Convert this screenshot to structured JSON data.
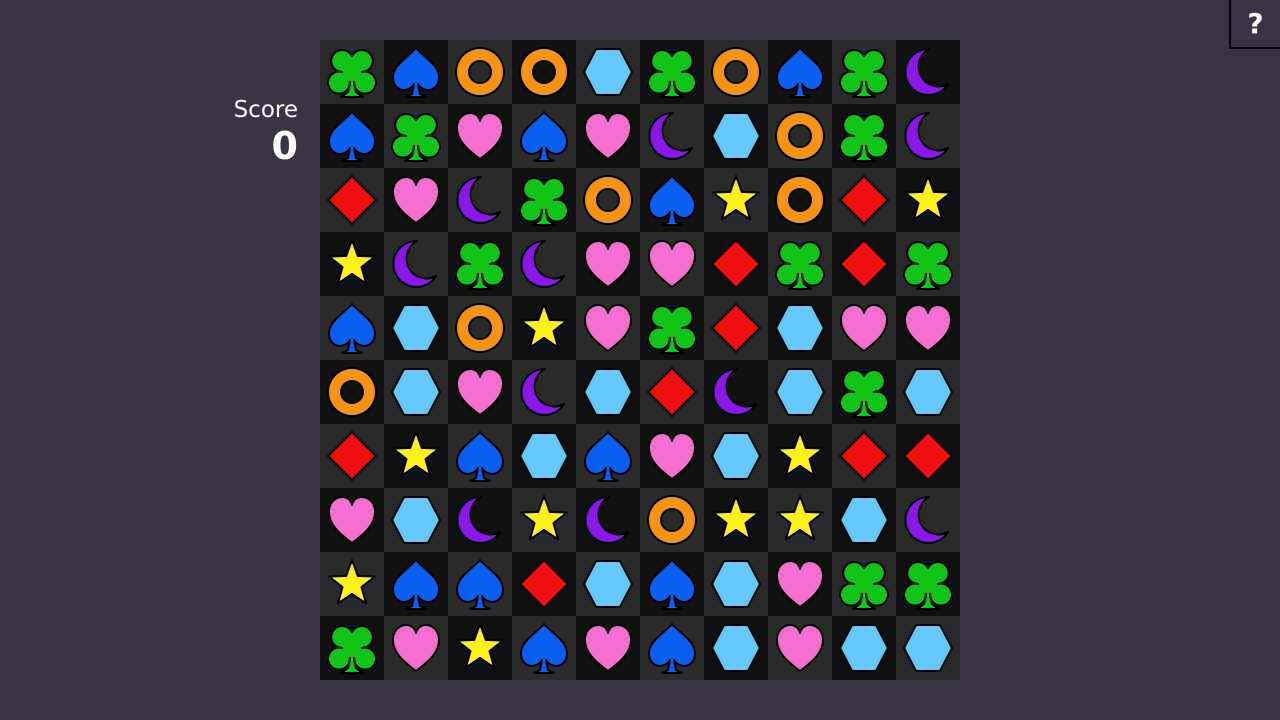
{
  "score": {
    "label": "Score",
    "value": "0"
  },
  "help_button": {
    "label": "?"
  },
  "board": {
    "rows": [
      [
        "club",
        "spade",
        "ring",
        "ring",
        "hexagon",
        "club",
        "ring",
        "spade",
        "club",
        "moon"
      ],
      [
        "spade",
        "club",
        "heart",
        "spade",
        "heart",
        "moon",
        "hexagon",
        "ring",
        "club",
        "moon"
      ],
      [
        "diamond",
        "heart",
        "moon",
        "club",
        "ring",
        "spade",
        "star",
        "ring",
        "diamond",
        "star"
      ],
      [
        "star",
        "moon",
        "club",
        "moon",
        "heart",
        "heart",
        "diamond",
        "club",
        "diamond",
        "club"
      ],
      [
        "spade",
        "hexagon",
        "ring",
        "star",
        "heart",
        "club",
        "diamond",
        "hexagon",
        "heart",
        "heart"
      ],
      [
        "ring",
        "hexagon",
        "heart",
        "moon",
        "hexagon",
        "diamond",
        "moon",
        "hexagon",
        "club",
        "hexagon"
      ],
      [
        "diamond",
        "star",
        "spade",
        "hexagon",
        "spade",
        "heart",
        "hexagon",
        "star",
        "diamond",
        "diamond"
      ],
      [
        "heart",
        "hexagon",
        "moon",
        "star",
        "moon",
        "ring",
        "star",
        "star",
        "hexagon",
        "moon"
      ],
      [
        "star",
        "spade",
        "spade",
        "diamond",
        "hexagon",
        "spade",
        "hexagon",
        "heart",
        "club",
        "club"
      ],
      [
        "club",
        "heart",
        "star",
        "spade",
        "heart",
        "spade",
        "hexagon",
        "heart",
        "hexagon",
        "hexagon"
      ]
    ]
  },
  "colors": {
    "background": "#3a3343",
    "cell_dark": "#101010",
    "cell_light": "#2a2a2a",
    "club": "#12c31a",
    "spade": "#0a5ef0",
    "ring": "#f59414",
    "hexagon": "#66c8fa",
    "heart": "#f46fd0",
    "moon": "#8a16e8",
    "diamond": "#f00f0f",
    "star": "#fff21c"
  },
  "icons": {
    "club": "club-icon",
    "spade": "spade-icon",
    "ring": "ring-icon",
    "hexagon": "hexagon-icon",
    "heart": "heart-icon",
    "moon": "moon-icon",
    "diamond": "diamond-icon",
    "star": "star-icon"
  }
}
